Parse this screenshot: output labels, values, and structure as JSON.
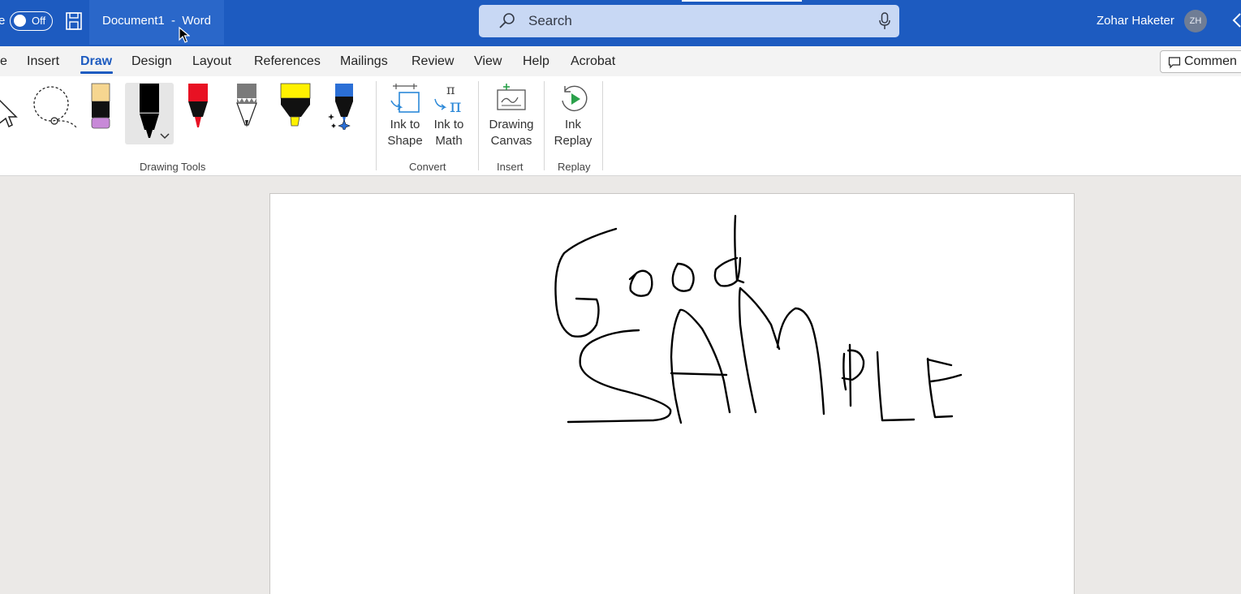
{
  "titlebar": {
    "autosave_label": "e",
    "autosave_state": "Off",
    "doc_title": "Document1  -  Word",
    "search_placeholder": "Search",
    "user_name": "Zohar Haketer",
    "user_initials": "ZH"
  },
  "tabs": [
    {
      "label": "e"
    },
    {
      "label": "Insert"
    },
    {
      "label": "Draw"
    },
    {
      "label": "Design"
    },
    {
      "label": "Layout"
    },
    {
      "label": "References"
    },
    {
      "label": "Mailings"
    },
    {
      "label": "Review"
    },
    {
      "label": "View"
    },
    {
      "label": "Help"
    },
    {
      "label": "Acrobat"
    }
  ],
  "active_tab": "Draw",
  "comments_label": "Commen",
  "ribbon": {
    "drawing_tools_label": "Drawing Tools",
    "convert": {
      "label": "Convert",
      "ink_to_shape": [
        "Ink to",
        "Shape"
      ],
      "ink_to_math": [
        "Ink to",
        "Math"
      ]
    },
    "insert": {
      "label": "Insert",
      "drawing_canvas": [
        "Drawing",
        "Canvas"
      ]
    },
    "replay": {
      "label": "Replay",
      "ink_replay": [
        "Ink",
        "Replay"
      ]
    },
    "pens": [
      {
        "name": "eraser",
        "color": "#f2d59a"
      },
      {
        "name": "black-pen",
        "color": "#000000"
      },
      {
        "name": "red-pen",
        "color": "#e81123"
      },
      {
        "name": "gray-pencil",
        "color": "#7a7a7a"
      },
      {
        "name": "yellow-highlighter",
        "color": "#fff100"
      },
      {
        "name": "blue-galaxy-pen",
        "color": "#2b6fd6"
      }
    ]
  },
  "colors": {
    "titlebar": "#1d5bc0",
    "accent": "#1d5bc0",
    "ink": "#000000"
  }
}
